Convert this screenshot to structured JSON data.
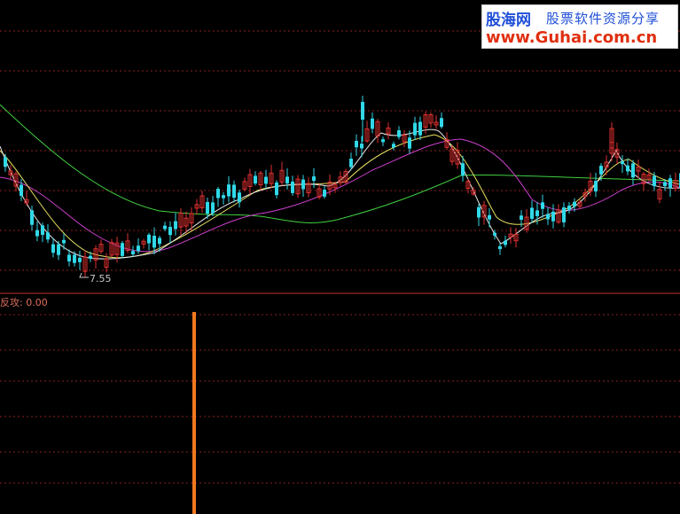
{
  "logo": {
    "brand": "股海网",
    "tagline": "股票软件资源分享",
    "url": "www.Guhai.com.cn"
  },
  "indicator": {
    "name": "反攻",
    "value": "0.00",
    "signal_bar_color": "#f07820"
  },
  "price_low_label": "7.55",
  "colors": {
    "up": "#e03030",
    "down": "#30d8e8",
    "ma5": "#e8e8e8",
    "ma10": "#e8e060",
    "ma20": "#d040d0",
    "ma60": "#40d040",
    "grid": "#8a2020",
    "divider": "#c03030"
  },
  "chart_data": {
    "type": "candlestick",
    "series": [
      {
        "type": "candles",
        "values": [
          8.5,
          9.8,
          9.2,
          9.0,
          9.4,
          8.3,
          8.0
        ]
      },
      {
        "type": "line",
        "values": [
          9.1,
          8.9,
          8.4
        ]
      },
      {
        "type": "line",
        "values": [
          8.9,
          8.7,
          8.1
        ]
      },
      {
        "type": "line",
        "values": [
          8.0,
          8.3,
          8.2
        ]
      }
    ],
    "annotations": [
      {
        "type": "price-low",
        "value": 7.55
      },
      {
        "type": "indicator-signal",
        "value": 0.0
      }
    ]
  }
}
